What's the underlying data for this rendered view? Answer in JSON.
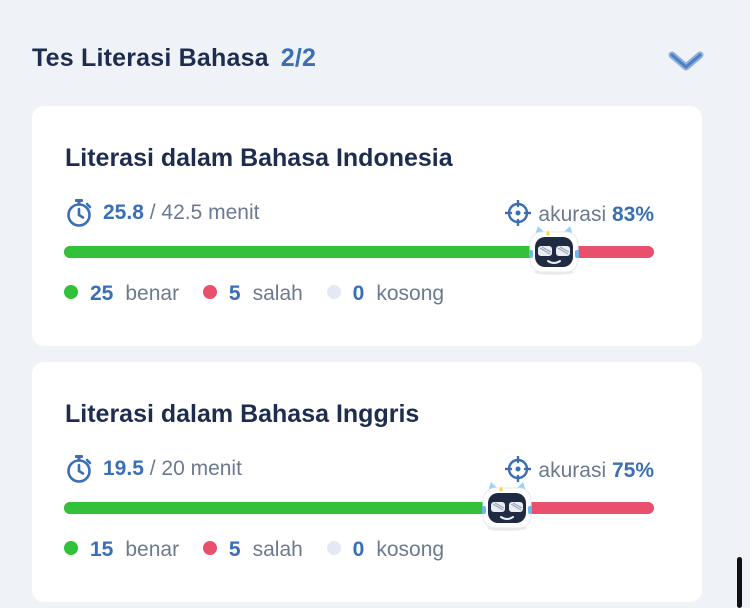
{
  "section": {
    "title": "Tes Literasi Bahasa",
    "count": "2/2"
  },
  "colors": {
    "correct": "#33c13a",
    "wrong": "#e8506e",
    "empty": "#e3e9f3",
    "accent": "#3a6fb5"
  },
  "cards": [
    {
      "title": "Literasi dalam Bahasa Indonesia",
      "time_used": "25.8",
      "time_total": "/ 42.5 menit",
      "accuracy_label": "akurasi",
      "accuracy_value": "83%",
      "accuracy_fraction": 0.83,
      "correct_count": "25",
      "correct_label": "benar",
      "wrong_count": "5",
      "wrong_label": "salah",
      "empty_count": "0",
      "empty_label": "kosong"
    },
    {
      "title": "Literasi dalam Bahasa Inggris",
      "time_used": "19.5",
      "time_total": "/ 20 menit",
      "accuracy_label": "akurasi",
      "accuracy_value": "75%",
      "accuracy_fraction": 0.75,
      "correct_count": "15",
      "correct_label": "benar",
      "wrong_count": "5",
      "wrong_label": "salah",
      "empty_count": "0",
      "empty_label": "kosong"
    }
  ]
}
